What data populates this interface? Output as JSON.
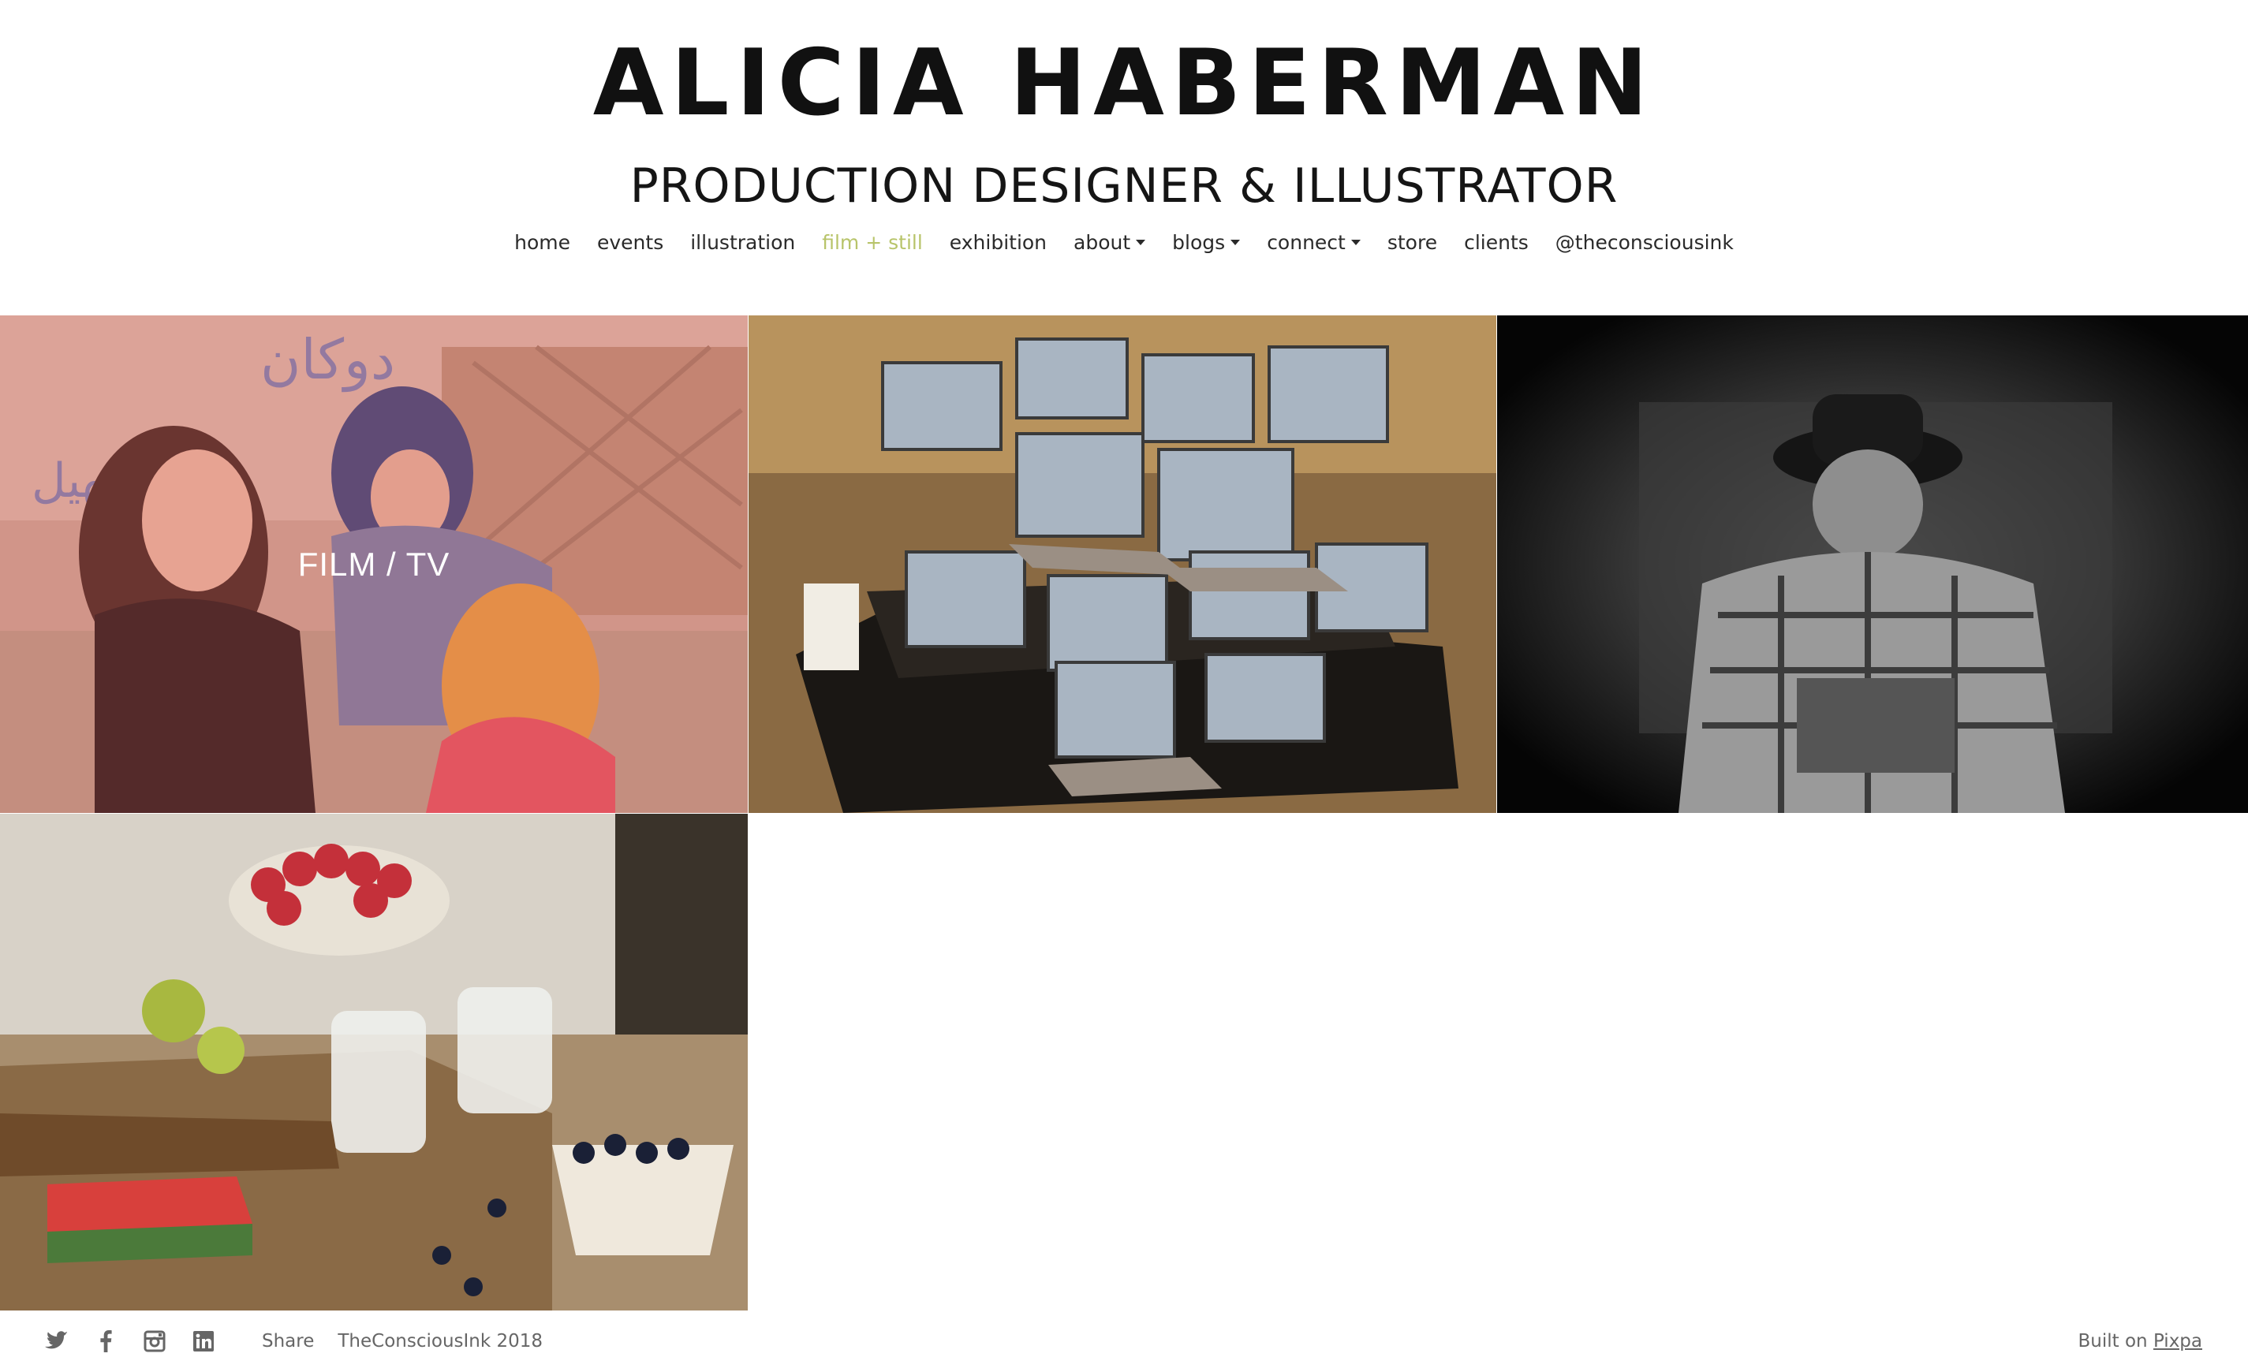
{
  "header": {
    "name": "ALICIA HABERMAN",
    "subtitle": "PRODUCTION DESIGNER & ILLUSTRATOR"
  },
  "nav": {
    "items": [
      {
        "label": "home"
      },
      {
        "label": "events"
      },
      {
        "label": "illustration"
      },
      {
        "label": "film + still",
        "active": true
      },
      {
        "label": "exhibition"
      },
      {
        "label": "about",
        "dropdown": true
      },
      {
        "label": "blogs",
        "dropdown": true
      },
      {
        "label": "connect",
        "dropdown": true
      },
      {
        "label": "store"
      },
      {
        "label": "clients"
      },
      {
        "label": "@theconsciousink"
      }
    ]
  },
  "gallery": {
    "tiles": [
      {
        "label": "FILM / TV",
        "icon": "film-tv-photo"
      },
      {
        "label": "",
        "icon": "laptops-exhibit-photo"
      },
      {
        "label": "",
        "icon": "man-in-hat-photo"
      },
      {
        "label": "",
        "icon": "fruit-table-photo"
      }
    ]
  },
  "footer": {
    "social": [
      "twitter-icon",
      "facebook-icon",
      "instagram-icon",
      "linkedin-icon"
    ],
    "share_label": "Share",
    "copyright": "TheConsciousInk 2018",
    "built_on_prefix": "Built on",
    "built_on_link": "Pixpa"
  },
  "colors": {
    "accent": "#b8c46a",
    "text": "#2a2a2a",
    "footer_text": "#666666"
  }
}
